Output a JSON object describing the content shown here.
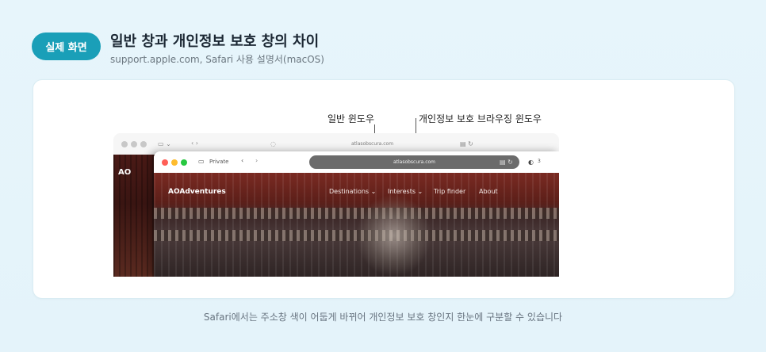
{
  "header": {
    "badge": "실제 화면",
    "title": "일반 창과 개인정보 보호 창의 차이",
    "subtitle": "support.apple.com, Safari 사용 설명서(macOS)"
  },
  "annotations": {
    "normal_window": "일반 윈도우",
    "private_window": "개인정보 보호 브라우징 윈도우"
  },
  "back_window": {
    "url": "atlasobscura.com",
    "logo": "AO"
  },
  "front_window": {
    "private_label": "Private",
    "url": "atlasobscura.com",
    "tab_count": "3",
    "logo": "AOAdventures",
    "nav": [
      "Destinations ⌄",
      "Interests ⌄",
      "Trip finder",
      "About"
    ]
  },
  "caption": "Safari에서는 주소창 색이 어둡게 바뀌어 개인정보 보호 창인지 한눈에 구분할 수 있습니다",
  "colors": {
    "badge": "#1a9fb8",
    "background": "#e6f4fa",
    "private_url_bar": "#6b6b6b"
  }
}
